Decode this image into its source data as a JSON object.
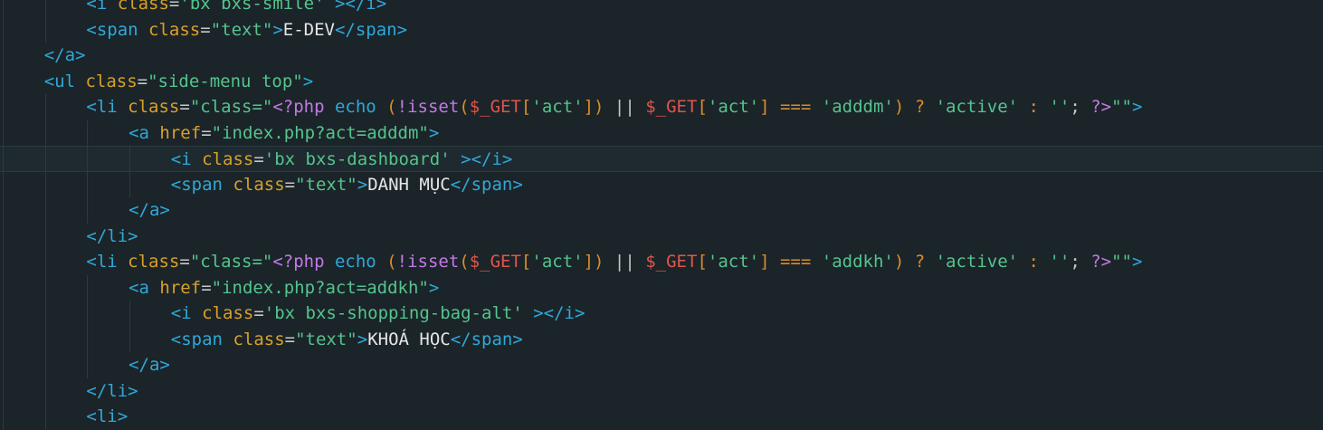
{
  "editor": {
    "lines": [
      {
        "indent": 2,
        "current": false,
        "tokens": [
          {
            "c": "t-tag",
            "v": "<i"
          },
          {
            "c": "t-attr",
            "v": " class"
          },
          {
            "c": "t-eq",
            "v": "="
          },
          {
            "c": "t-str",
            "v": "'bx bxs-smile'"
          },
          {
            "c": "t-tag",
            "v": " ></i>"
          }
        ]
      },
      {
        "indent": 2,
        "current": false,
        "tokens": [
          {
            "c": "t-tag",
            "v": "<span"
          },
          {
            "c": "t-attr",
            "v": " class"
          },
          {
            "c": "t-eq",
            "v": "="
          },
          {
            "c": "t-str",
            "v": "\"text\""
          },
          {
            "c": "t-tag",
            "v": ">"
          },
          {
            "c": "t-text",
            "v": "E-DEV"
          },
          {
            "c": "t-tag",
            "v": "</span>"
          }
        ]
      },
      {
        "indent": 1,
        "current": false,
        "tokens": [
          {
            "c": "t-tag",
            "v": "</a>"
          }
        ]
      },
      {
        "indent": 1,
        "current": false,
        "tokens": [
          {
            "c": "t-tag",
            "v": "<ul"
          },
          {
            "c": "t-attr",
            "v": " class"
          },
          {
            "c": "t-eq",
            "v": "="
          },
          {
            "c": "t-str",
            "v": "\"side-menu top\""
          },
          {
            "c": "t-tag",
            "v": ">"
          }
        ]
      },
      {
        "indent": 2,
        "current": false,
        "tokens": [
          {
            "c": "t-tag",
            "v": "<li"
          },
          {
            "c": "t-attr",
            "v": " class"
          },
          {
            "c": "t-eq",
            "v": "="
          },
          {
            "c": "t-str",
            "v": "\"class=\""
          },
          {
            "c": "t-php",
            "v": "<?php"
          },
          {
            "c": "t-tag",
            "v": " echo"
          },
          {
            "c": "t-op",
            "v": " ("
          },
          {
            "c": "t-php",
            "v": "!isset"
          },
          {
            "c": "t-op",
            "v": "("
          },
          {
            "c": "t-var",
            "v": "$_GET"
          },
          {
            "c": "t-op",
            "v": "["
          },
          {
            "c": "t-str",
            "v": "'act'"
          },
          {
            "c": "t-op",
            "v": "])"
          },
          {
            "c": "t-punc",
            "v": " || "
          },
          {
            "c": "t-var",
            "v": "$_GET"
          },
          {
            "c": "t-op",
            "v": "["
          },
          {
            "c": "t-str",
            "v": "'act'"
          },
          {
            "c": "t-op",
            "v": "]"
          },
          {
            "c": "t-op",
            "v": " === "
          },
          {
            "c": "t-str",
            "v": "'adddm'"
          },
          {
            "c": "t-op",
            "v": ") ? "
          },
          {
            "c": "t-str",
            "v": "'active'"
          },
          {
            "c": "t-op",
            "v": " : "
          },
          {
            "c": "t-str",
            "v": "''"
          },
          {
            "c": "t-punc",
            "v": "; "
          },
          {
            "c": "t-php",
            "v": "?>"
          },
          {
            "c": "t-str",
            "v": "\"\""
          },
          {
            "c": "t-tag",
            "v": ">"
          }
        ]
      },
      {
        "indent": 3,
        "current": false,
        "tokens": [
          {
            "c": "t-tag",
            "v": "<a"
          },
          {
            "c": "t-attr",
            "v": " href"
          },
          {
            "c": "t-eq",
            "v": "="
          },
          {
            "c": "t-str",
            "v": "\"index.php?act=adddm\""
          },
          {
            "c": "t-tag",
            "v": ">"
          }
        ]
      },
      {
        "indent": 4,
        "current": true,
        "tokens": [
          {
            "c": "t-tag",
            "v": "<i"
          },
          {
            "c": "t-attr",
            "v": " class"
          },
          {
            "c": "t-eq",
            "v": "="
          },
          {
            "c": "t-str",
            "v": "'bx bxs-dashboard'"
          },
          {
            "c": "t-tag",
            "v": " ></i>"
          }
        ]
      },
      {
        "indent": 4,
        "current": false,
        "tokens": [
          {
            "c": "t-tag",
            "v": "<span"
          },
          {
            "c": "t-attr",
            "v": " class"
          },
          {
            "c": "t-eq",
            "v": "="
          },
          {
            "c": "t-str",
            "v": "\"text\""
          },
          {
            "c": "t-tag",
            "v": ">"
          },
          {
            "c": "t-text",
            "v": "DANH MỤC"
          },
          {
            "c": "t-tag",
            "v": "</span>"
          }
        ]
      },
      {
        "indent": 3,
        "current": false,
        "tokens": [
          {
            "c": "t-tag",
            "v": "</a>"
          }
        ]
      },
      {
        "indent": 2,
        "current": false,
        "tokens": [
          {
            "c": "t-tag",
            "v": "</li>"
          }
        ]
      },
      {
        "indent": 2,
        "current": false,
        "tokens": [
          {
            "c": "t-tag",
            "v": "<li"
          },
          {
            "c": "t-attr",
            "v": " class"
          },
          {
            "c": "t-eq",
            "v": "="
          },
          {
            "c": "t-str",
            "v": "\"class=\""
          },
          {
            "c": "t-php",
            "v": "<?php"
          },
          {
            "c": "t-tag",
            "v": " echo"
          },
          {
            "c": "t-op",
            "v": " ("
          },
          {
            "c": "t-php",
            "v": "!isset"
          },
          {
            "c": "t-op",
            "v": "("
          },
          {
            "c": "t-var",
            "v": "$_GET"
          },
          {
            "c": "t-op",
            "v": "["
          },
          {
            "c": "t-str",
            "v": "'act'"
          },
          {
            "c": "t-op",
            "v": "])"
          },
          {
            "c": "t-punc",
            "v": " || "
          },
          {
            "c": "t-var",
            "v": "$_GET"
          },
          {
            "c": "t-op",
            "v": "["
          },
          {
            "c": "t-str",
            "v": "'act'"
          },
          {
            "c": "t-op",
            "v": "]"
          },
          {
            "c": "t-op",
            "v": " === "
          },
          {
            "c": "t-str",
            "v": "'addkh'"
          },
          {
            "c": "t-op",
            "v": ") ? "
          },
          {
            "c": "t-str",
            "v": "'active'"
          },
          {
            "c": "t-op",
            "v": " : "
          },
          {
            "c": "t-str",
            "v": "''"
          },
          {
            "c": "t-punc",
            "v": "; "
          },
          {
            "c": "t-php",
            "v": "?>"
          },
          {
            "c": "t-str",
            "v": "\"\""
          },
          {
            "c": "t-tag",
            "v": ">"
          }
        ]
      },
      {
        "indent": 3,
        "current": false,
        "tokens": [
          {
            "c": "t-tag",
            "v": "<a"
          },
          {
            "c": "t-attr",
            "v": " href"
          },
          {
            "c": "t-eq",
            "v": "="
          },
          {
            "c": "t-str",
            "v": "\"index.php?act=addkh\""
          },
          {
            "c": "t-tag",
            "v": ">"
          }
        ]
      },
      {
        "indent": 4,
        "current": false,
        "tokens": [
          {
            "c": "t-tag",
            "v": "<i"
          },
          {
            "c": "t-attr",
            "v": " class"
          },
          {
            "c": "t-eq",
            "v": "="
          },
          {
            "c": "t-str",
            "v": "'bx bxs-shopping-bag-alt'"
          },
          {
            "c": "t-tag",
            "v": " ></i>"
          }
        ]
      },
      {
        "indent": 4,
        "current": false,
        "tokens": [
          {
            "c": "t-tag",
            "v": "<span"
          },
          {
            "c": "t-attr",
            "v": " class"
          },
          {
            "c": "t-eq",
            "v": "="
          },
          {
            "c": "t-str",
            "v": "\"text\""
          },
          {
            "c": "t-tag",
            "v": ">"
          },
          {
            "c": "t-text",
            "v": "KHOÁ HỌC"
          },
          {
            "c": "t-tag",
            "v": "</span>"
          }
        ]
      },
      {
        "indent": 3,
        "current": false,
        "tokens": [
          {
            "c": "t-tag",
            "v": "</a>"
          }
        ]
      },
      {
        "indent": 2,
        "current": false,
        "tokens": [
          {
            "c": "t-tag",
            "v": "</li>"
          }
        ]
      },
      {
        "indent": 2,
        "current": false,
        "tokens": [
          {
            "c": "t-tag",
            "v": "<li>"
          }
        ]
      }
    ]
  }
}
